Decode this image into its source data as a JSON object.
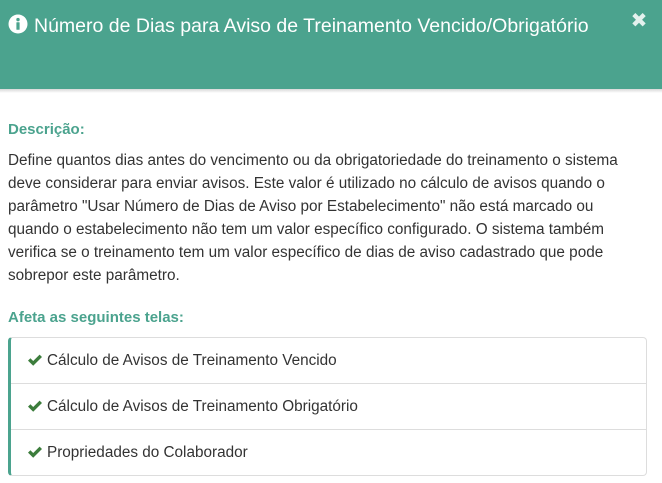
{
  "header": {
    "title": "Número de Dias para Aviso de Treinamento Vencido/Obrigatório",
    "title_icon": "info-circle-icon",
    "close_icon": "close-icon",
    "close_glyph": "✖",
    "background_color": "#4ba38e"
  },
  "body": {
    "description_heading": "Descrição:",
    "description_text": "Define quantos dias antes do vencimento ou da obrigatoriedade do treinamento o sistema deve considerar para enviar avisos. Este valor é utilizado no cálculo de avisos quando o parâmetro \"Usar Número de Dias de Aviso por Estabelecimento\" não está marcado ou quando o estabelecimento não tem um valor específico configurado. O sistema também verifica se o treinamento tem um valor específico de dias de aviso cadastrado que pode sobrepor este parâmetro.",
    "affects_heading": "Afeta as seguintes telas:",
    "screens": [
      {
        "label": "Cálculo de Avisos de Treinamento Vencido",
        "icon": "check-icon"
      },
      {
        "label": "Cálculo de Avisos de Treinamento Obrigatório",
        "icon": "check-icon"
      },
      {
        "label": "Propriedades do Colaborador",
        "icon": "check-icon"
      }
    ],
    "accent_color": "#4ba38e",
    "check_color": "#3c7d3c"
  }
}
